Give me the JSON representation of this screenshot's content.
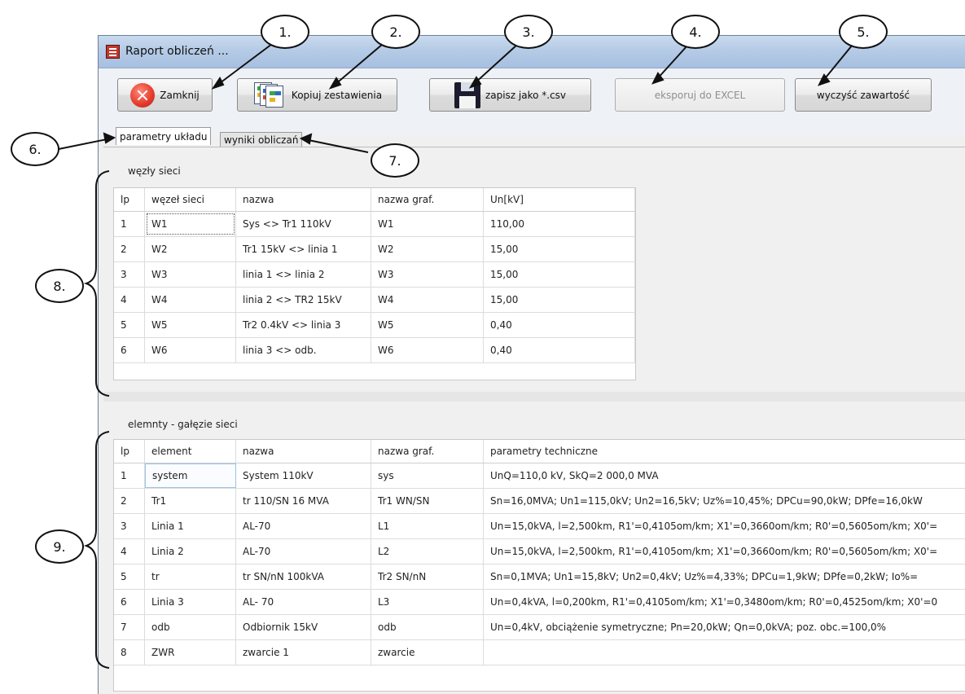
{
  "window": {
    "title": "Raport obliczeń ..."
  },
  "toolbar": {
    "close_label": "Zamknij",
    "copy_label": "Kopiuj zestawienia",
    "save_csv_label": "zapisz jako *.csv",
    "export_excel_label": "eksporuj do EXCEL",
    "clear_label": "wyczyść zawartość"
  },
  "tabs": [
    {
      "label": "parametry układu",
      "active": true
    },
    {
      "label": "wyniki obliczań",
      "active": false
    }
  ],
  "nodes": {
    "title": "węzły sieci",
    "columns": [
      "lp",
      "węzeł sieci",
      "nazwa",
      "nazwa graf.",
      "Un[kV]"
    ],
    "rows": [
      [
        "1",
        "W1",
        "Sys <> Tr1 110kV",
        "W1",
        "110,00"
      ],
      [
        "2",
        "W2",
        "Tr1 15kV <> linia 1",
        "W2",
        "15,00"
      ],
      [
        "3",
        "W3",
        "linia 1 <> linia 2",
        "W3",
        "15,00"
      ],
      [
        "4",
        "W4",
        "linia 2 <> TR2 15kV",
        "W4",
        "15,00"
      ],
      [
        "5",
        "W5",
        "Tr2 0.4kV <> linia 3",
        "W5",
        "0,40"
      ],
      [
        "6",
        "W6",
        "linia 3 <> odb.",
        "W6",
        "0,40"
      ]
    ]
  },
  "elements": {
    "title": "elemnty - gałęzie sieci",
    "columns": [
      "lp",
      "element",
      "nazwa",
      "nazwa graf.",
      "parametry techniczne"
    ],
    "rows": [
      [
        "1",
        "system",
        "System 110kV",
        "sys",
        "UnQ=110,0 kV,  SkQ=2 000,0 MVA"
      ],
      [
        "2",
        "Tr1",
        "tr 110/SN 16 MVA",
        "Tr1 WN/SN",
        "Sn=16,0MVA; Un1=115,0kV; Un2=16,5kV; Uz%=10,45%; DPCu=90,0kW; DPfe=16,0kW"
      ],
      [
        "3",
        "Linia 1",
        "AL-70",
        "L1",
        "Un=15,0kVA, l=2,500km, R1'=0,4105om/km; X1'=0,3660om/km; R0'=0,5605om/km; X0'="
      ],
      [
        "4",
        "Linia 2",
        "AL-70",
        "L2",
        "Un=15,0kVA, l=2,500km, R1'=0,4105om/km; X1'=0,3660om/km; R0'=0,5605om/km; X0'="
      ],
      [
        "5",
        "tr",
        "tr SN/nN 100kVA",
        "Tr2 SN/nN",
        "Sn=0,1MVA; Un1=15,8kV; Un2=0,4kV; Uz%=4,33%; DPCu=1,9kW; DPfe=0,2kW; Io%="
      ],
      [
        "6",
        "Linia 3",
        "AL- 70",
        "L3",
        "Un=0,4kVA, l=0,200km, R1'=0,4105om/km; X1'=0,3480om/km; R0'=0,4525om/km; X0'=0"
      ],
      [
        "7",
        "odb",
        "Odbiornik 15kV",
        "odb",
        "Un=0,4kV, obciążenie symetryczne; Pn=20,0kW; Qn=0,0kVA; poz. obc.=100,0%"
      ],
      [
        "8",
        "ZWR",
        "zwarcie 1",
        "zwarcie",
        ""
      ]
    ]
  },
  "callouts": [
    "1.",
    "2.",
    "3.",
    "4.",
    "5.",
    "6.",
    "7.",
    "8.",
    "9."
  ],
  "icons": [
    "app-icon",
    "close-icon",
    "copy-icon",
    "save-icon"
  ],
  "colors": {
    "title_bar": "#b5cbe6",
    "close_red": "#e33a2a",
    "grid_border": "#dcdcdc"
  }
}
